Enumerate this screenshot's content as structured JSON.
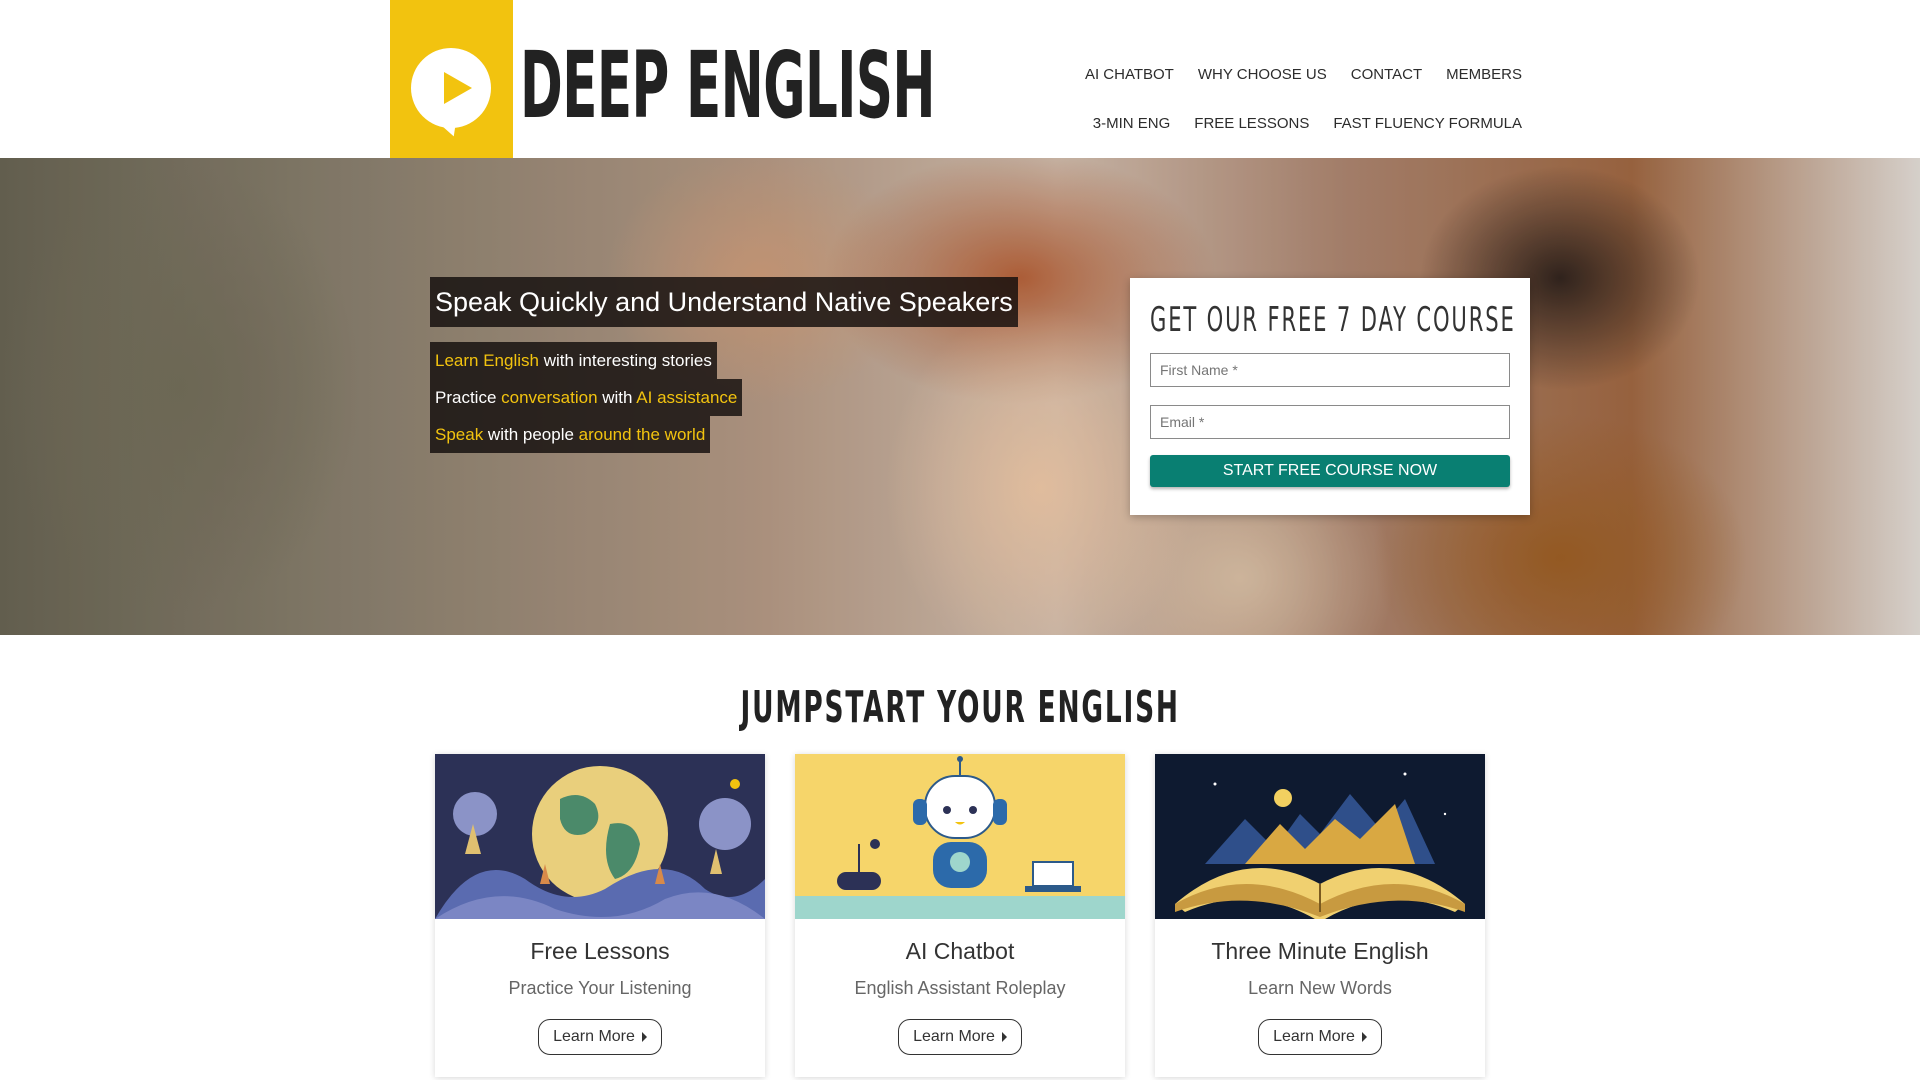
{
  "brand": {
    "name": "DEEP ENGLISH",
    "logo_color": "#f2c30f",
    "logo_icon": "play-icon"
  },
  "nav": {
    "row1": [
      "AI CHATBOT",
      "WHY CHOOSE US",
      "CONTACT",
      "MEMBERS"
    ],
    "row2": [
      "3-MIN ENG",
      "FREE LESSONS",
      "FAST FLUENCY FORMULA"
    ]
  },
  "hero": {
    "headline": "Speak Quickly and Understand Native Speakers",
    "tag1": {
      "a": "Learn English",
      "b": " with interesting stories"
    },
    "tag2": {
      "a": "Practice ",
      "b": "conversation",
      "c": " with ",
      "d": "AI assistance"
    },
    "tag3": {
      "a": "Speak",
      "b": " with people ",
      "c": "around the world"
    },
    "highlight_color": "#f2c30f"
  },
  "form": {
    "title": "GET OUR FREE 7 DAY COURSE",
    "first_name_placeholder": "First Name *",
    "email_placeholder": "Email *",
    "submit_label": "START FREE COURSE NOW",
    "button_color": "#097f72"
  },
  "section": {
    "title": "JUMPSTART YOUR ENGLISH"
  },
  "cards": [
    {
      "title": "Free Lessons",
      "subtitle": "Practice Your Listening",
      "button": "Learn More"
    },
    {
      "title": "AI Chatbot",
      "subtitle": "English Assistant Roleplay",
      "button": "Learn More"
    },
    {
      "title": "Three Minute English",
      "subtitle": "Learn New Words",
      "button": "Learn More"
    }
  ]
}
